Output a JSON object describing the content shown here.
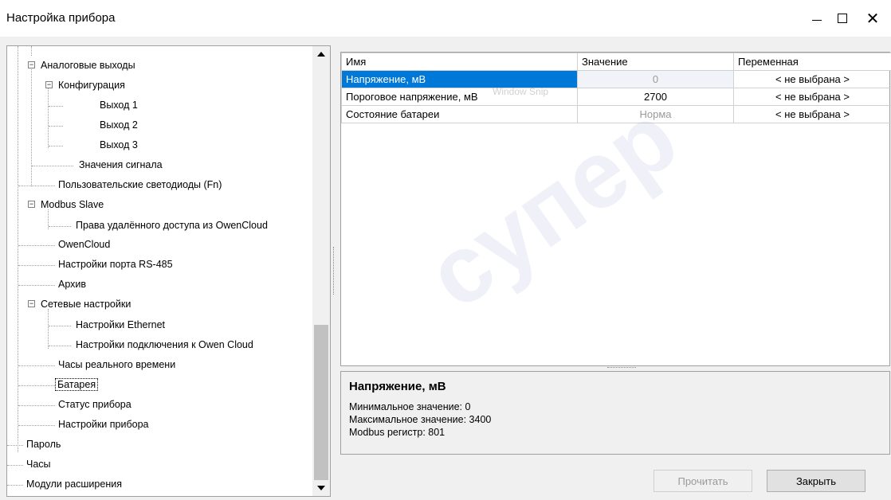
{
  "window": {
    "title": "Настройка прибора",
    "minimize": "—",
    "maximize": "",
    "close": "✕"
  },
  "tree": {
    "items": [
      {
        "label": "Аналоговые выходы",
        "expander": "−"
      },
      {
        "label": "Конфигурация",
        "expander": "−"
      },
      {
        "label": "Выход 1"
      },
      {
        "label": "Выход 2"
      },
      {
        "label": "Выход 3"
      },
      {
        "label": "Значения сигнала"
      },
      {
        "label": "Пользовательские светодиоды (Fn)"
      },
      {
        "label": "Modbus Slave",
        "expander": "−"
      },
      {
        "label": "Права удалённого доступа из OwenCloud"
      },
      {
        "label": "OwenCloud"
      },
      {
        "label": "Настройки порта RS-485"
      },
      {
        "label": "Архив"
      },
      {
        "label": "Сетевые настройки",
        "expander": "−"
      },
      {
        "label": "Настройки Ethernet"
      },
      {
        "label": "Настройки подключения к Owen Cloud"
      },
      {
        "label": "Часы реального времени"
      },
      {
        "label": "Батарея",
        "selected": true
      },
      {
        "label": "Статус прибора"
      },
      {
        "label": "Настройки прибора"
      },
      {
        "label": "Пароль"
      },
      {
        "label": "Часы"
      },
      {
        "label": "Модули расширения"
      }
    ]
  },
  "grid": {
    "headers": [
      "Имя",
      "Значение",
      "Переменная"
    ],
    "rows": [
      {
        "name": "Напряжение, мВ",
        "value": "0",
        "variable": "< не выбрана >"
      },
      {
        "name": "Пороговое напряжение, мВ",
        "value": "2700",
        "variable": "< не выбрана >"
      },
      {
        "name": "Состояние батареи",
        "value": "Норма",
        "variable": "< не выбрана >"
      }
    ]
  },
  "description": {
    "title": "Напряжение, мВ",
    "lines": [
      "Минимальное значение: 0",
      "Максимальное значение: 3400",
      "Modbus регистр: 801"
    ]
  },
  "buttons": {
    "read": "Прочитать",
    "close": "Закрыть"
  },
  "overlay": {
    "snip": "Window Snip",
    "watermark": "супер"
  },
  "colors": {
    "selection": "#0078d7",
    "watermark": "#7882c8"
  }
}
